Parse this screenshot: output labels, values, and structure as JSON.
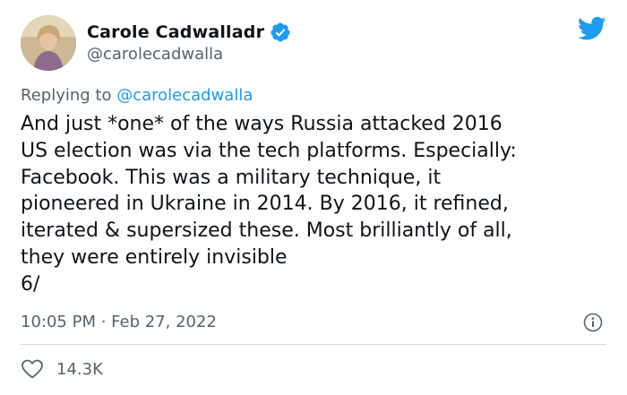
{
  "author": {
    "display_name": "Carole Cadwalladr",
    "handle": "@carolecadwalla",
    "verified": true
  },
  "reply": {
    "prefix": "Replying to ",
    "to": "@carolecadwalla"
  },
  "tweet": {
    "lines": [
      "And just *one* of the ways Russia attacked 2016",
      "US election was via the tech platforms. Especially:",
      "Facebook. This was a military technique, it",
      "pioneered in Ukraine in 2014. By 2016, it refined,",
      "iterated & supersized these. Most brilliantly of all,",
      "they were entirely invisible",
      "6/"
    ],
    "timestamp": "10:05 PM · Feb 27, 2022"
  },
  "engagement": {
    "likes": "14.3K"
  },
  "icons": {
    "brand": "twitter-bird-icon",
    "verified": "verified-badge-icon",
    "info": "info-icon",
    "like": "heart-icon"
  },
  "colors": {
    "brand_blue": "#1d9bf0",
    "text": "#0f1419",
    "secondary": "#536471",
    "divider": "#cfd9de"
  }
}
